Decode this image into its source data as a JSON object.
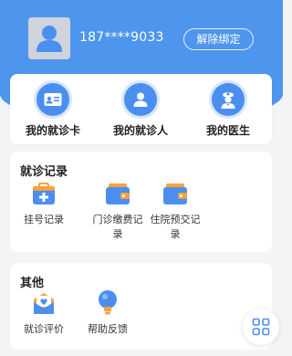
{
  "profile": {
    "phone": "187****9033",
    "unbind_label": "解除绑定"
  },
  "quick": {
    "items": [
      {
        "label": "我的就诊卡",
        "icon": "id-card-icon"
      },
      {
        "label": "我的就诊人",
        "icon": "person-icon"
      },
      {
        "label": "我的医生",
        "icon": "doctor-icon"
      }
    ]
  },
  "records": {
    "title": "就诊记录",
    "items": [
      {
        "label": "挂号记录",
        "icon": "medical-kit-icon"
      },
      {
        "label": "门诊缴费记录",
        "icon": "wallet-icon"
      },
      {
        "label": "住院预交记录",
        "icon": "wallet-icon"
      }
    ]
  },
  "other": {
    "title": "其他",
    "items": [
      {
        "label": "就诊评价",
        "icon": "heart-envelope-icon"
      },
      {
        "label": "帮助反馈",
        "icon": "lightbulb-icon"
      }
    ]
  },
  "colors": {
    "primary": "#4e95ee",
    "accent_orange": "#f7a23b",
    "page_bg": "#f3f4f6"
  },
  "float_button": {
    "icon": "grid-icon"
  }
}
